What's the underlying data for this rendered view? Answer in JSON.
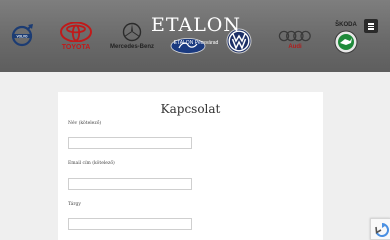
{
  "header": {
    "brand_title": "ETALON",
    "brand_subtitle": "ETALON Pécsvárad",
    "logos": [
      {
        "name": "volvo-logo",
        "caption": ""
      },
      {
        "name": "toyota-logo",
        "caption": "TOYOTA"
      },
      {
        "name": "mercedes-logo",
        "caption": "Mercedes-Benz"
      },
      {
        "name": "ford-logo",
        "caption": ""
      },
      {
        "name": "volkswagen-logo",
        "caption": ""
      },
      {
        "name": "audi-logo",
        "caption": "Audi"
      },
      {
        "name": "skoda-logo",
        "caption": "ŠKODA"
      }
    ],
    "menu_icon": "hamburger-icon"
  },
  "form": {
    "title": "Kapcsolat",
    "fields": [
      {
        "label": "Név (kötelező)",
        "value": ""
      },
      {
        "label": "Email cím (kötelező)",
        "value": ""
      },
      {
        "label": "Tárgy",
        "value": ""
      }
    ]
  },
  "recaptcha_icon": "recaptcha-icon",
  "colors": {
    "header_bg": "#707070",
    "page_bg": "#efefef",
    "card_bg": "#ffffff",
    "menu_button": "#2a2a2a"
  }
}
